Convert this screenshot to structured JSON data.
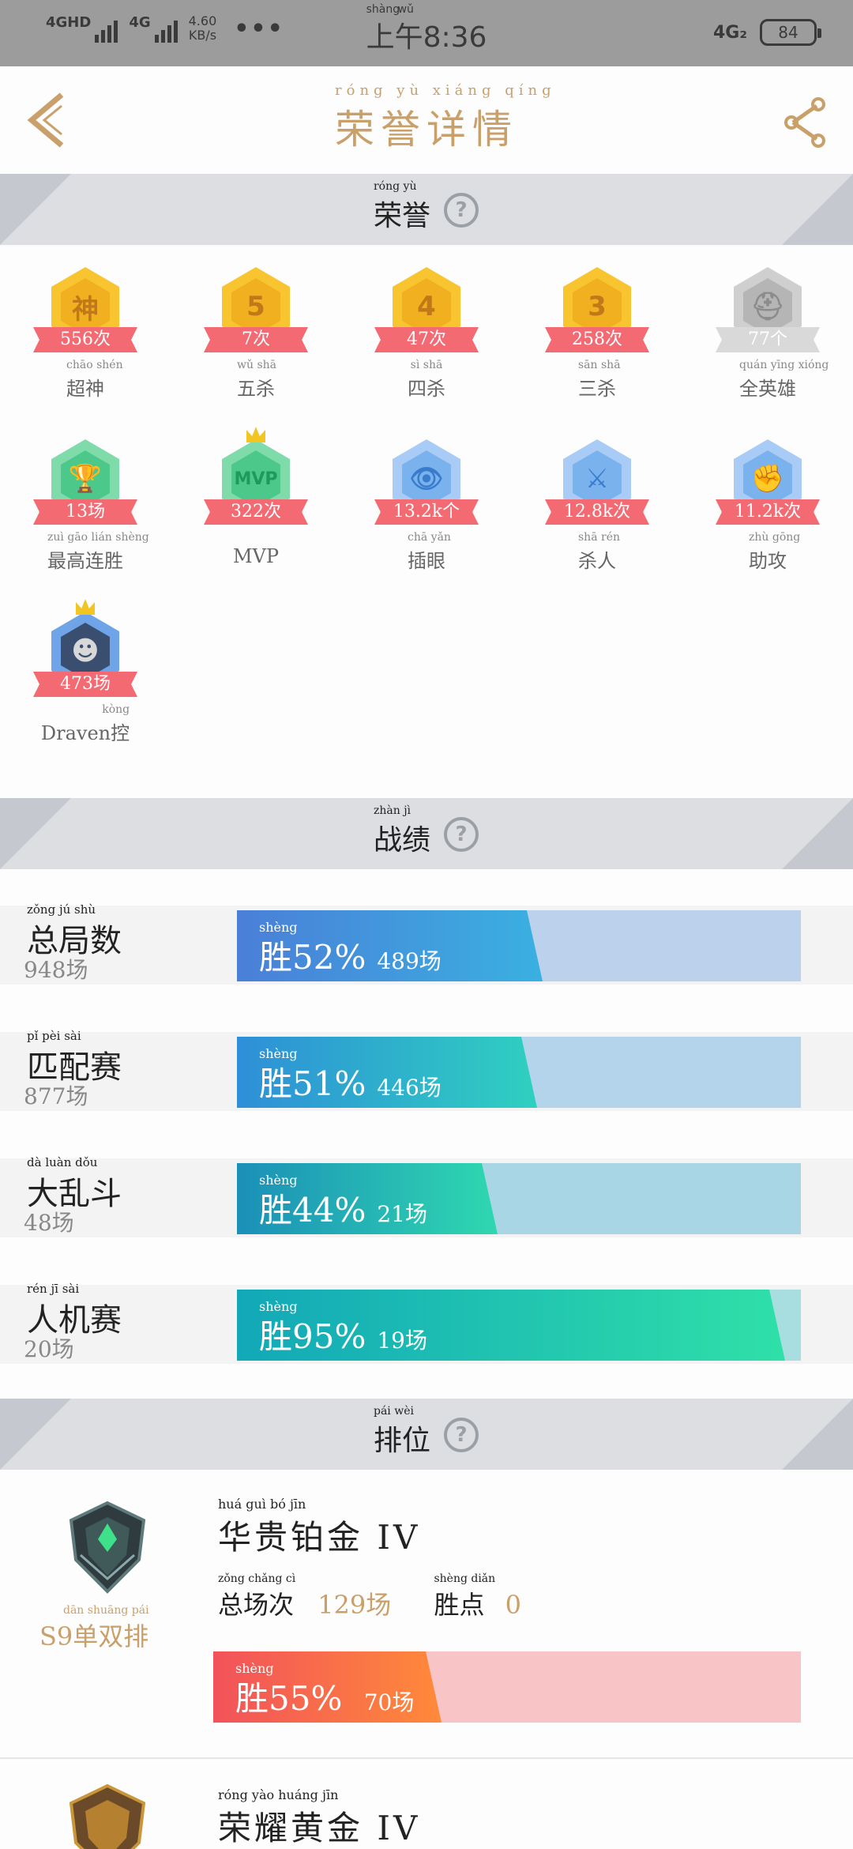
{
  "status_bar": {
    "net1": "4GHD",
    "net2": "4G",
    "speed_value": "4.60",
    "speed_unit": "KB/s",
    "more": "•••",
    "time": "上午8:36",
    "time_pinyin_1": "shàng",
    "time_pinyin_2": "wǔ",
    "net_right": "4G₂",
    "battery": "84"
  },
  "header": {
    "title": "荣誉详情",
    "title_pinyin": [
      "róng",
      "yù",
      "xiáng",
      "qíng"
    ],
    "back_icon": "chevron-left-icon",
    "share_icon": "share-icon"
  },
  "sections": {
    "honor": {
      "title": "荣誉",
      "pinyin": "róng  yù"
    },
    "record": {
      "title": "战绩",
      "pinyin": "zhàn  jì"
    },
    "rank": {
      "title": "排位",
      "pinyin": "pái  wèi"
    },
    "help_glyph": "?"
  },
  "honors": [
    {
      "badge": "神",
      "count": "556次",
      "label": "超神",
      "pinyin": "chāo shén",
      "style": "gold"
    },
    {
      "badge": "5",
      "count": "7次",
      "label": "五杀",
      "pinyin": "wǔ  shā",
      "style": "gold"
    },
    {
      "badge": "4",
      "count": "47次",
      "label": "四杀",
      "pinyin": "sì  shā",
      "style": "gold"
    },
    {
      "badge": "3",
      "count": "258次",
      "label": "三杀",
      "pinyin": "sān  shā",
      "style": "gold"
    },
    {
      "badge": "⛑",
      "count": "77个",
      "label": "全英雄",
      "pinyin": "quán yīng xióng",
      "style": "grey"
    },
    {
      "badge": "🏆",
      "count": "13场",
      "label": "最高连胜",
      "pinyin": "zuì gāo lián shèng",
      "style": "green"
    },
    {
      "badge": "MVP",
      "count": "322次",
      "label": "MVP",
      "pinyin": "",
      "style": "green"
    },
    {
      "badge": "👁",
      "count": "13.2k个",
      "label": "插眼",
      "pinyin": "chā yǎn",
      "style": "blue"
    },
    {
      "badge": "⚔",
      "count": "12.8k次",
      "label": "杀人",
      "pinyin": "shā rén",
      "style": "blue"
    },
    {
      "badge": "✊",
      "count": "11.2k次",
      "label": "助攻",
      "pinyin": "zhù gōng",
      "style": "blue"
    },
    {
      "badge": "☻",
      "count": "473场",
      "label": "Draven控",
      "pinyin": "kòng",
      "style": "portrait"
    }
  ],
  "records": [
    {
      "name": "总局数",
      "name_pinyin": "zǒng  jú  shù",
      "count": "948场",
      "win": "胜52%",
      "games": "489场",
      "win_rate": 0.52,
      "gradient": [
        "#4a7fd8",
        "#3ab0e0"
      ],
      "track": "#bcd2ec"
    },
    {
      "name": "匹配赛",
      "name_pinyin": "pǐ  pèi  sài",
      "count": "877场",
      "win": "胜51%",
      "games": "446场",
      "win_rate": 0.51,
      "gradient": [
        "#2e8fd8",
        "#2fd0c0"
      ],
      "track": "#b4d4ec"
    },
    {
      "name": "大乱斗",
      "name_pinyin": "dà  luàn  dǒu",
      "count": "48场",
      "win": "胜44%",
      "games": "21场",
      "win_rate": 0.44,
      "gradient": [
        "#1b8fb8",
        "#2fd8b0"
      ],
      "track": "#a8d6e4"
    },
    {
      "name": "人机赛",
      "name_pinyin": "rén  jī  sài",
      "count": "20场",
      "win": "胜95%",
      "games": "19场",
      "win_rate": 0.95,
      "gradient": [
        "#12a8b8",
        "#2fe0a8"
      ],
      "track": "#a8dee0"
    }
  ],
  "ranks": [
    {
      "queue": "S9单双排",
      "queue_pinyin": "dān shuāng pái",
      "tier": "华贵铂金 IV",
      "tier_pinyin": "huá  guì  bó  jīn",
      "total_label": "总场次",
      "total_pinyin": "zǒng chǎng cì",
      "total": "129场",
      "points_label": "胜点",
      "points_pinyin": "shèng diǎn",
      "points": "0",
      "win": "胜55%",
      "games": "70场",
      "win_rate": 0.55
    },
    {
      "tier": "荣耀黄金 IV",
      "tier_pinyin": "róng  yào  huáng  jīn"
    }
  ],
  "colors": {
    "accent_gold": "#c9a06a",
    "ribbon_red": "#f36a73",
    "rank_bar": [
      "#f2525a",
      "#ff8a3a"
    ]
  }
}
